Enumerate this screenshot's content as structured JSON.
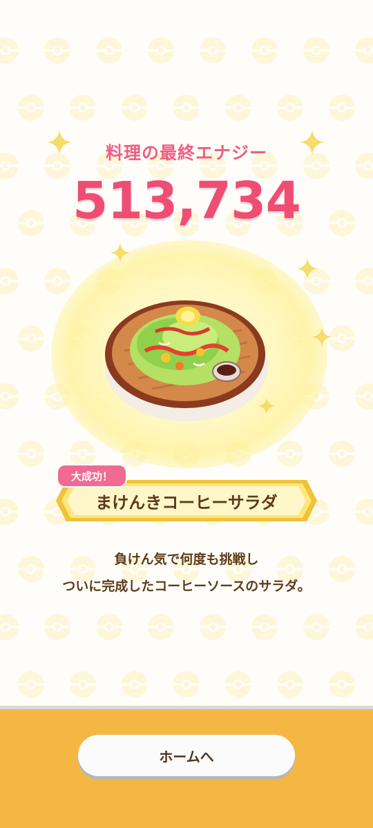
{
  "result": {
    "title": "料理の最終エナジー",
    "energy": "513,734"
  },
  "dish": {
    "badge": "大成功！",
    "name": "まけんきコーヒーサラダ",
    "description_line1": "負けん気で何度も挑戦し",
    "description_line2": "ついに完成したコーヒーソースのサラダ。"
  },
  "footer": {
    "home_label": "ホームへ"
  },
  "colors": {
    "accent_pink": "#f04d74",
    "footer_orange": "#f5b744",
    "text_brown": "#5b3a1c"
  }
}
